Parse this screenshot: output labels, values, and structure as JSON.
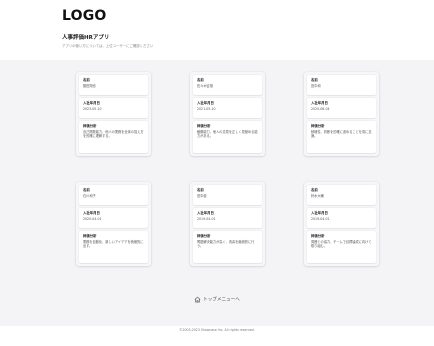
{
  "header": {
    "logo": "LOGO",
    "app_title": "人事評価HRアプリ",
    "subtitle": "アプリの使い方については、上位ユーザーにご確認ください"
  },
  "cards": [
    {
      "name_label": "名前",
      "name": "藤田翔也",
      "date_label": "入社年月日",
      "date": "2023-05-10",
      "eval_label": "評価分析",
      "eval": "自己開発能力、他人の業務を全体の捉え方を的確に理解する。"
    },
    {
      "name_label": "名前",
      "name": "佐々木征雄",
      "date_label": "入社年月日",
      "date": "2021-05-10",
      "eval_label": "評価分析",
      "eval": "観察能力、他人の意見を正しく見極める能力がある。"
    },
    {
      "name_label": "名前",
      "name": "田中和",
      "date_label": "入社年月日",
      "date": "2020-08-04",
      "eval_label": "評価分析",
      "eval": "積極性、判断を的確に進めることを常に意識。"
    },
    {
      "name_label": "名前",
      "name": "石川和子",
      "date_label": "入社年月日",
      "date": "2020-04-01",
      "eval_label": "評価分析",
      "eval": "業務を自動化、新しいアイデアを積極的に出す。"
    },
    {
      "name_label": "名前",
      "name": "田中健",
      "date_label": "入社年月日",
      "date": "2019-04-01",
      "eval_label": "評価分析",
      "eval": "問題解決能力が高く、改善を継続的に行う。"
    },
    {
      "name_label": "名前",
      "name": "鈴木大輔",
      "date_label": "入社年月日",
      "date": "2019-04-01",
      "eval_label": "評価分析",
      "eval": "周囲との協力、チームで目標達成に向けて取り組む。"
    }
  ],
  "nav": {
    "top_menu": "トップメニューへ",
    "icon": "home-icon"
  },
  "footer": {
    "copyright": "©2005-2023 Showcase Inc. All rights reserved."
  }
}
